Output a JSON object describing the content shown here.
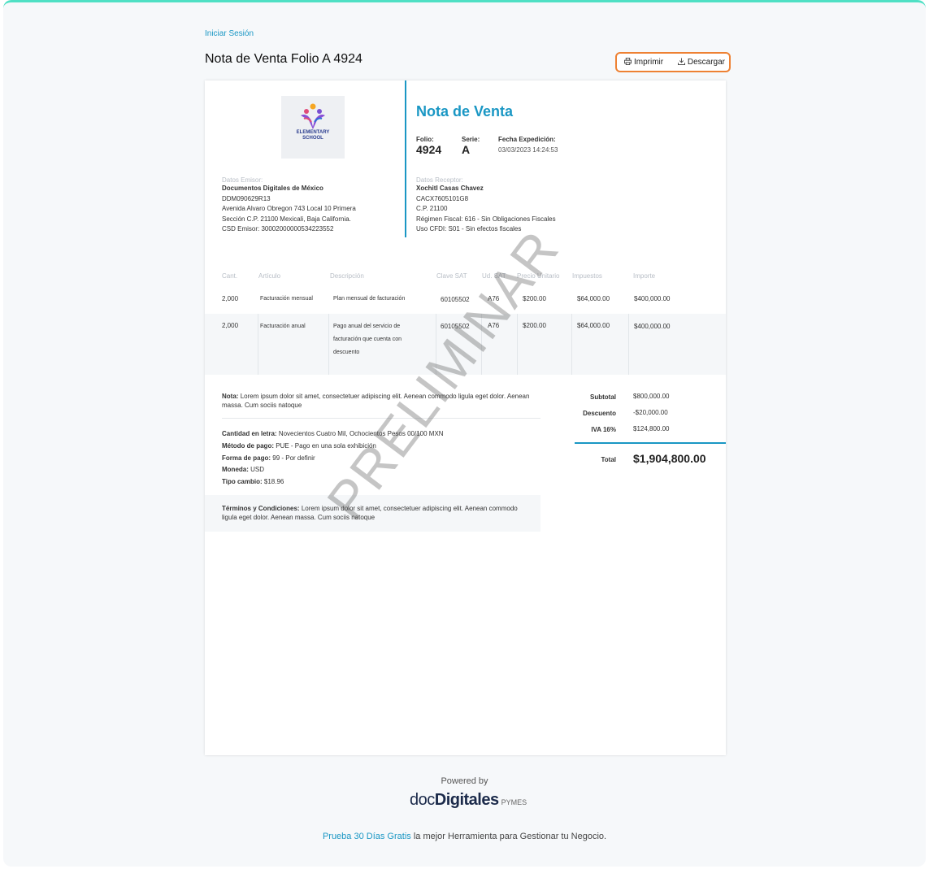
{
  "colors": {
    "accent": "#1a97c4",
    "highlight": "#ee8133",
    "topbar": "#4fe0c4"
  },
  "header": {
    "login": "Iniciar Sesión",
    "title": "Nota de Venta Folio A 4924",
    "print": "Imprimir",
    "download": "Descargar",
    "print_icon": "printer-icon",
    "download_icon": "download-icon"
  },
  "doc": {
    "title": "Nota de Venta",
    "logo": {
      "line1": "ELEMENTARY",
      "line2": "SCHOOL"
    },
    "folio_label": "Folio:",
    "folio": "4924",
    "serie_label": "Serie:",
    "serie": "A",
    "fecha_label": "Fecha Expedición:",
    "fecha": "03/03/2023 14:24:53",
    "emisor": {
      "label": "Datos Emisor:",
      "name": "Documentos Digitales de México",
      "rfc": "DDM090629R13",
      "address1": "Avenida Alvaro Obregon 743 Local 10 Primera",
      "address2": "Sección C.P. 21100 Mexicali, Baja California.",
      "csd": "CSD Emisor: 30002000000534223552"
    },
    "receptor": {
      "label": "Datos Receptor:",
      "name": "Xochitl Casas Chavez",
      "rfc": "CACX7605101G8",
      "cp": "C.P. 21100",
      "regimen": "Régimen Fiscal: 616 - Sin Obligaciones Fiscales",
      "uso": "Uso CFDI: S01 - Sin efectos fiscales"
    },
    "columns": [
      "Cant.",
      "Artículo",
      "Descripción",
      "Clave SAT",
      "Ud. SAT",
      "Precio Unitario",
      "Impuestos",
      "Importe"
    ],
    "rows": [
      {
        "cant": "2,000",
        "articulo": "Facturación mensual",
        "descripcion": "Plan mensual de facturación",
        "clave": "60105502",
        "ud": "A76",
        "precio": "$200.00",
        "impuestos": "$64,000.00",
        "importe": "$400,000.00"
      },
      {
        "cant": "2,000",
        "articulo": "Facturación anual",
        "descripcion": "Pago anual del servicio de facturación que cuenta con descuento",
        "clave": "60105502",
        "ud": "A76",
        "precio": "$200.00",
        "impuestos": "$64,000.00",
        "importe": "$400,000.00"
      }
    ],
    "nota": {
      "label": "Nota:",
      "text": "Lorem ipsum dolor sit amet, consectetuer adipiscing elit. Aenean commodo ligula eget dolor. Aenean massa. Cum sociis natoque"
    },
    "payment": [
      {
        "label": "Cantidad en letra:",
        "value": "Novecientos Cuatro Mil, Ochocientos Pesos 00/100 MXN"
      },
      {
        "label": "Método de pago:",
        "value": "PUE - Pago en una sola exhibición"
      },
      {
        "label": "Forma de pago:",
        "value": "99 - Por definir"
      },
      {
        "label": "Moneda:",
        "value": "USD"
      },
      {
        "label": "Tipo cambio:",
        "value": "$18.96"
      }
    ],
    "terms": {
      "label": "Términos y Condiciones:",
      "text": "Lorem ipsum dolor sit amet, consectetuer adipiscing elit. Aenean commodo ligula eget dolor. Aenean massa. Cum sociis natoque"
    },
    "totals": {
      "subtotal_label": "Subtotal",
      "subtotal": "$800,000.00",
      "descuento_label": "Descuento",
      "descuento": "-$20,000.00",
      "iva_label": "IVA 16%",
      "iva": "$124,800.00",
      "total_label": "Total",
      "total": "$1,904,800.00"
    },
    "watermark": "PRELIMINAR"
  },
  "footer": {
    "powered": "Powered by",
    "brand_doc": "doc",
    "brand_digitales": "Digitales",
    "brand_pymes": "PYMES",
    "promo_link": "Prueba 30 Días Gratis",
    "promo_text": " la mejor Herramienta para Gestionar tu Negocio."
  }
}
